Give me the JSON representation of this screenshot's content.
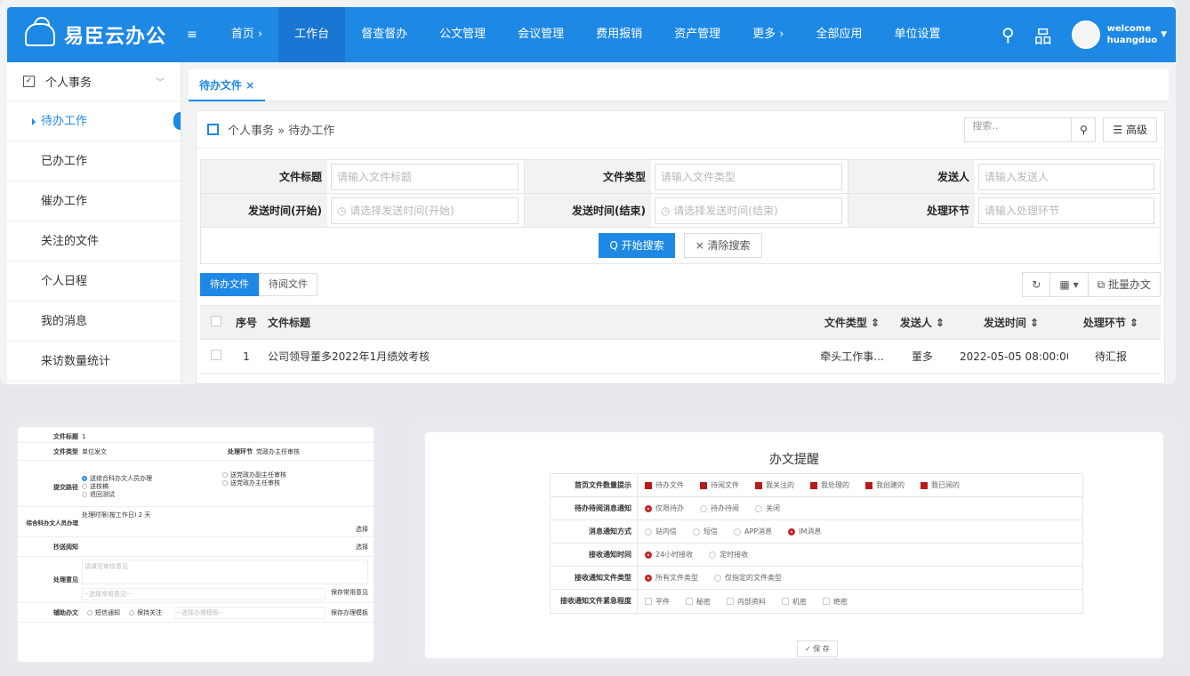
{
  "brand": {
    "name": "易臣云办公",
    "menu_icon": "≡"
  },
  "nav": [
    "首页 ›",
    "工作台",
    "督查督办",
    "公文管理",
    "会议管理",
    "费用报销",
    "资产管理",
    "更多 ›",
    "全部应用",
    "单位设置"
  ],
  "user": {
    "line1": "welcome",
    "line2": "huangduo"
  },
  "sidebar": {
    "head": "个人事务",
    "items": [
      "待办工作",
      "已办工作",
      "催办工作",
      "关注的文件",
      "个人日程",
      "我的消息",
      "来访数量统计"
    ]
  },
  "tab": "待办文件 ×",
  "crumb": "个人事务 » 待办工作",
  "search": {
    "placeholder": "搜索..",
    "adv": "☰ 高级"
  },
  "filter": {
    "r1": [
      [
        "文件标题",
        "请输入文件标题"
      ],
      [
        "文件类型",
        "请输入文件类型"
      ],
      [
        "发送人",
        "请输入发送人"
      ]
    ],
    "r2": [
      [
        "发送时间(开始)",
        "◷ 请选择发送时间(开始)"
      ],
      [
        "发送时间(结束)",
        "◷ 请选择发送时间(结束)"
      ],
      [
        "处理环节",
        "请输入处理环节"
      ]
    ],
    "search_btn": "Q 开始搜索",
    "clear_btn": "× 清除搜索"
  },
  "list_tabs": [
    "待办文件",
    "待阅文件"
  ],
  "list_tools": [
    "↻",
    "▦ ▾",
    "⧉ 批量办文"
  ],
  "table": {
    "headers": [
      "序号",
      "文件标题",
      "文件类型 ⇕",
      "发送人 ⇕",
      "发送时间 ⇕",
      "处理环节 ⇕"
    ],
    "rows": [
      [
        "1",
        "公司领导董多2022年1月绩效考核",
        "牵头工作事...",
        "董多",
        "2022-05-05 08:00:00",
        "待汇报"
      ]
    ]
  },
  "form2": {
    "title_label": "文件标题",
    "title_val": "1",
    "type_label": "文件类型",
    "type_val": "单位发文",
    "stage_label": "处理环节",
    "stage_val": "党政办主任审核",
    "route_label": "提交路径",
    "route_opts": [
      "送综合科办文人员办理",
      "送核稿",
      "退回测试"
    ],
    "route_opts2": [
      "送党政办副主任审核",
      "送党政办主任审核"
    ],
    "deal_label": "综合科办文人员办理",
    "deal_time": "处理时限(按工作日)  2  天",
    "select": "选择",
    "cc_label": "抄送阅知",
    "opinion_label": "处理意见",
    "opinion_ph": "请填写审核意见",
    "common_ph": "--选择常用意见--",
    "save_common": "保存常用意见",
    "assist_label": "辅助办文",
    "assist_opts": [
      "短信通知",
      "保持关注"
    ],
    "tpl_ph": "--选择办理模板--",
    "save_tpl": "保存办理模板"
  },
  "reminder": {
    "title": "办文提醒",
    "rows": [
      {
        "label": "首页文件数量提示",
        "type": "check",
        "opts": [
          [
            "待办文件",
            true
          ],
          [
            "待阅文件",
            true
          ],
          [
            "我关注的",
            true
          ],
          [
            "我处理的",
            true
          ],
          [
            "我创建的",
            true
          ],
          [
            "我已阅的",
            true
          ]
        ]
      },
      {
        "label": "待办待阅消息通知",
        "type": "radio",
        "opts": [
          [
            "仅限待办",
            true
          ],
          [
            "待办待阅",
            false
          ],
          [
            "关闭",
            false
          ]
        ]
      },
      {
        "label": "消息通知方式",
        "type": "radio",
        "opts": [
          [
            "站内信",
            false
          ],
          [
            "短信",
            false
          ],
          [
            "APP消息",
            false
          ],
          [
            "IM消息",
            true
          ]
        ]
      },
      {
        "label": "接收通知时间",
        "type": "radio",
        "opts": [
          [
            "24小时接收",
            true
          ],
          [
            "定时接收",
            false
          ]
        ]
      },
      {
        "label": "接收通知文件类型",
        "type": "radio",
        "opts": [
          [
            "所有文件类型",
            true
          ],
          [
            "仅指定的文件类型",
            false
          ]
        ]
      },
      {
        "label": "接收通知文件紧急程度",
        "type": "check",
        "opts": [
          [
            "平件",
            false
          ],
          [
            "秘密",
            false
          ],
          [
            "内部资料",
            false
          ],
          [
            "机密",
            false
          ],
          [
            "绝密",
            false
          ]
        ]
      }
    ],
    "save": "✓ 保 存"
  }
}
